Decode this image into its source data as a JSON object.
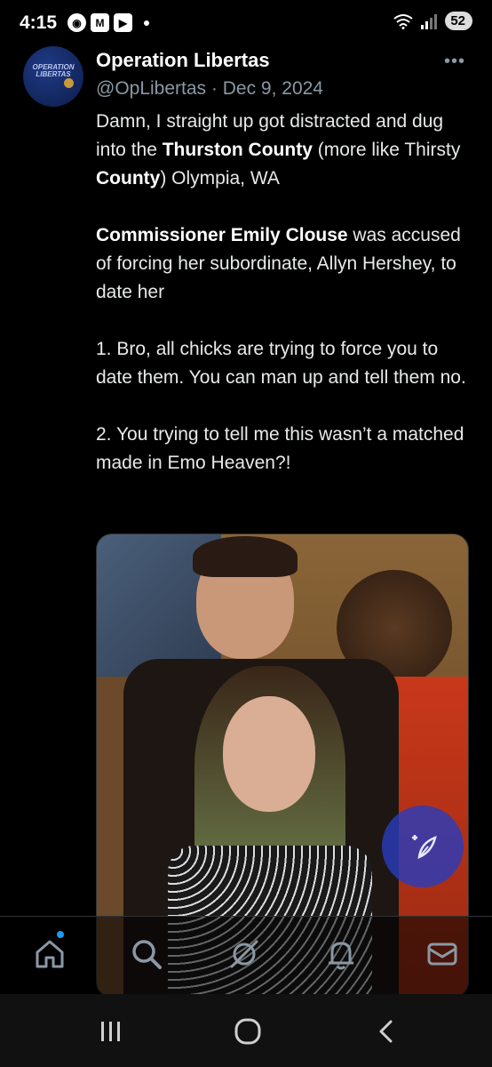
{
  "status_bar": {
    "time": "4:15",
    "battery": "52",
    "left_icons": [
      "record-icon",
      "gmail-icon",
      "youtube-icon",
      "dot-icon"
    ],
    "right_icons": [
      "wifi-icon",
      "signal-icon",
      "battery-icon"
    ]
  },
  "tweet": {
    "display_name": "Operation Libertas",
    "handle": "@OpLibertas",
    "separator": "·",
    "date": "Dec 9, 2024",
    "avatar_text": "OPERATION LIBERTAS",
    "more_icon": "more-icon",
    "body": {
      "p1_text1": "Damn, I straight up got distracted and dug into the ",
      "p1_bold1": "Thurston County",
      "p1_text2": " (more like Thirsty ",
      "p1_bold2": "County",
      "p1_text3": ") Olympia, WA",
      "p2_bold": "Commissioner Emily Clouse",
      "p2_text": " was accused of forcing her subordinate, Allyn Hershey, to date her",
      "p3": "1. Bro, all chicks are trying to force you to date them. You can man up and tell them no.",
      "p4": "2. You trying to tell me this wasn’t a matched made in Emo Heaven?!"
    }
  },
  "fab": {
    "icon": "compose-icon"
  },
  "bottom_nav": {
    "items": [
      {
        "icon": "home-icon"
      },
      {
        "icon": "search-icon"
      },
      {
        "icon": "grok-icon"
      },
      {
        "icon": "notifications-icon"
      },
      {
        "icon": "messages-icon"
      }
    ]
  },
  "system_nav": {
    "items": [
      {
        "icon": "recents-icon"
      },
      {
        "icon": "home-circle-icon"
      },
      {
        "icon": "back-icon"
      }
    ]
  },
  "colors": {
    "background": "#000000",
    "text": "#e7e9ea",
    "muted": "#8b98a5",
    "accent": "#1d9bf0",
    "fab": "#2c3cbe"
  }
}
